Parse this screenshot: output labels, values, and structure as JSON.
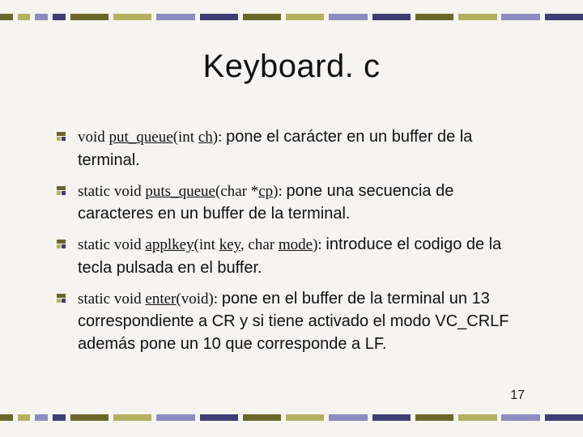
{
  "title": "Keyboard. c",
  "bullets": [
    {
      "sig_pre": "void ",
      "sig_fn": "put_queue",
      "sig_mid": "(int ",
      "sig_arg": "ch",
      "sig_post": "): ",
      "desc": "pone el carácter en un buffer de la terminal."
    },
    {
      "sig_pre": "static void ",
      "sig_fn": "puts_queue",
      "sig_mid": "(char *",
      "sig_arg": "cp",
      "sig_post": "): ",
      "desc": "pone una secuencia de caracteres en un buffer de la terminal."
    },
    {
      "sig_pre": "static void ",
      "sig_fn": "applkey",
      "sig_mid": "(int ",
      "sig_arg": "key",
      "sig_mid2": ", char ",
      "sig_arg2": "mode",
      "sig_post": "): ",
      "desc": "introduce el codigo de la tecla pulsada en el buffer."
    },
    {
      "sig_pre": "static void ",
      "sig_fn": "enter",
      "sig_mid": "(void): ",
      "sig_arg": "",
      "sig_post": "",
      "desc": "pone en el buffer de la terminal un 13 correspondiente a CR y si tiene activado el modo VC_CRLF además pone un 10 que corresponde a LF."
    }
  ],
  "page_number": "17"
}
